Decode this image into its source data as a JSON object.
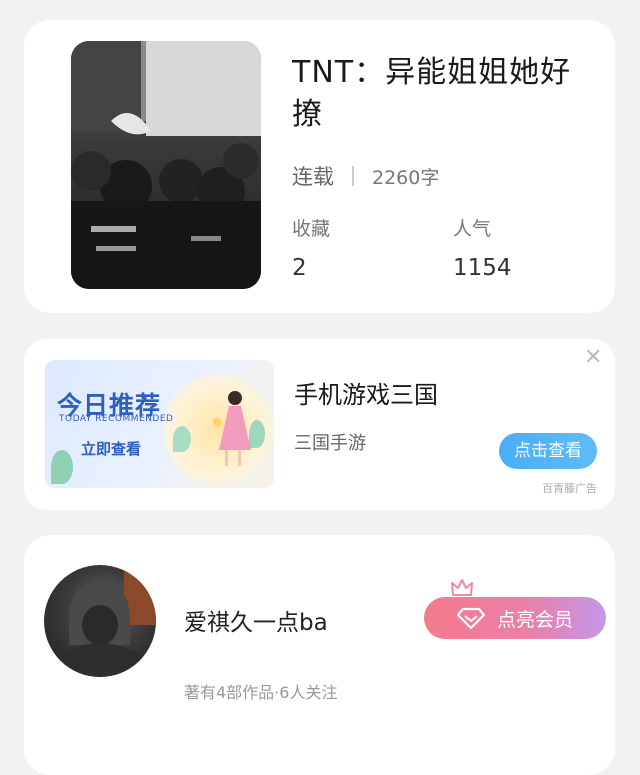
{
  "book": {
    "title": "TNT：异能姐姐她好撩",
    "status": "连载",
    "word_count": "2260字",
    "favorites_label": "收藏",
    "favorites_value": "2",
    "popularity_label": "人气",
    "popularity_value": "1154"
  },
  "ad": {
    "banner_title": "今日推荐",
    "banner_subtitle": "TODAY RECOMMENDED",
    "banner_cta": "立即查看",
    "title": "手机游戏三国",
    "subtitle": "三国手游",
    "button_label": "点击查看",
    "source": "百青藤广告",
    "close_symbol": "✕"
  },
  "author": {
    "name": "爱祺久一点ba",
    "stats": "著有4部作品·6人关注",
    "vip_label": "点亮会员"
  },
  "colors": {
    "background": "#f2f2f4",
    "ad_button": "#4aaef5",
    "vip_gradient_start": "#f47b8c",
    "vip_gradient_end": "#c596ea"
  },
  "icons": {
    "ad_close": "close-icon",
    "vip_gem": "diamond-icon",
    "vip_crown": "crown-icon"
  }
}
